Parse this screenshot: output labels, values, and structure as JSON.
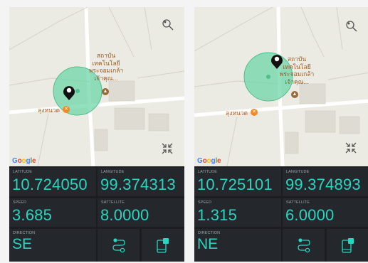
{
  "panels": [
    {
      "map": {
        "poi_name": "สถาบัน\nเทคโนโลยี\nพระจอมเกล้า\nเจ้าคุณ...",
        "local_place": "ลุงหนวด",
        "brand": "Google"
      },
      "latitude": {
        "label": "LATITUDE",
        "value": "10.724050"
      },
      "longitude": {
        "label": "LANGITUDE",
        "value": "99.374313"
      },
      "speed": {
        "label": "SPEED",
        "value": "3.685"
      },
      "satellite": {
        "label": "SATTELLITE",
        "value": "8.0000"
      },
      "direction": {
        "label": "DIRECTION",
        "value": "SE"
      }
    },
    {
      "map": {
        "poi_name": "สถาบัน\nเทคโนโลยี\nพระจอมเกล้า\nเจ้าคุณ...",
        "local_place": "ลุงหนวด",
        "brand": "Google"
      },
      "latitude": {
        "label": "LATITUDE",
        "value": "10.725101"
      },
      "longitude": {
        "label": "LANGITUDE",
        "value": "99.374893"
      },
      "speed": {
        "label": "SPEED",
        "value": "1.315"
      },
      "satellite": {
        "label": "SATTELLITE",
        "value": "6.0000"
      },
      "direction": {
        "label": "DIRECTION",
        "value": "NE"
      }
    }
  ],
  "colors": {
    "accent": "#27d6c1",
    "panel_bg": "#1b1d21",
    "cell_bg": "#24272c",
    "accuracy_circle": "#6fd6a8"
  },
  "icons": {
    "map_style": "map-style-icon",
    "fullscreen": "fullscreen-icon",
    "route": "route-icon",
    "phone": "phone-notify-icon"
  }
}
